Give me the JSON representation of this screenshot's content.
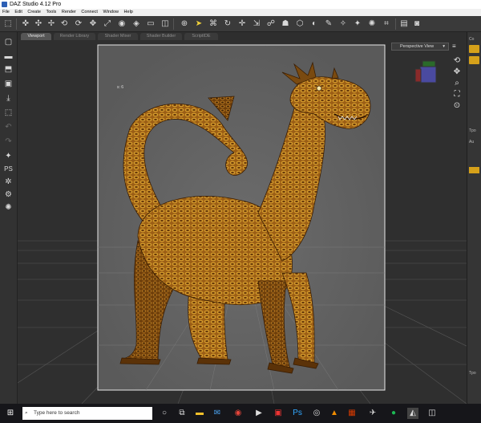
{
  "window": {
    "title": "DAZ Studio 4.12 Pro"
  },
  "menu": [
    "File",
    "Edit",
    "Create",
    "Tools",
    "Render",
    "Connect",
    "Window",
    "Help"
  ],
  "tabs": [
    {
      "label": "Viewport",
      "active": true
    },
    {
      "label": "Render Library",
      "active": false
    },
    {
      "label": "Shader Mixer",
      "active": false
    },
    {
      "label": "Shader Builder",
      "active": false
    },
    {
      "label": "ScriptIDE",
      "active": false
    }
  ],
  "viewport": {
    "camera": "Perspective View",
    "frame_label": "s: 6"
  },
  "right_panel": {
    "items": [
      "Co",
      "Tpo",
      "Au",
      "Tpo"
    ]
  },
  "taskbar": {
    "search_placeholder": "Type here to search",
    "apps": [
      "windows-logo",
      "cortana",
      "task-view",
      "file-explorer",
      "mail",
      "chrome",
      "media",
      "pdf",
      "photoshop",
      "app",
      "vlc",
      "office",
      "tablet",
      "spotify",
      "daz-studio",
      "shopping"
    ]
  },
  "colors": {
    "accent": "#d6a11a",
    "viewport_bg": "#2f2f2f",
    "frame_bg": "#6a6a6a"
  }
}
